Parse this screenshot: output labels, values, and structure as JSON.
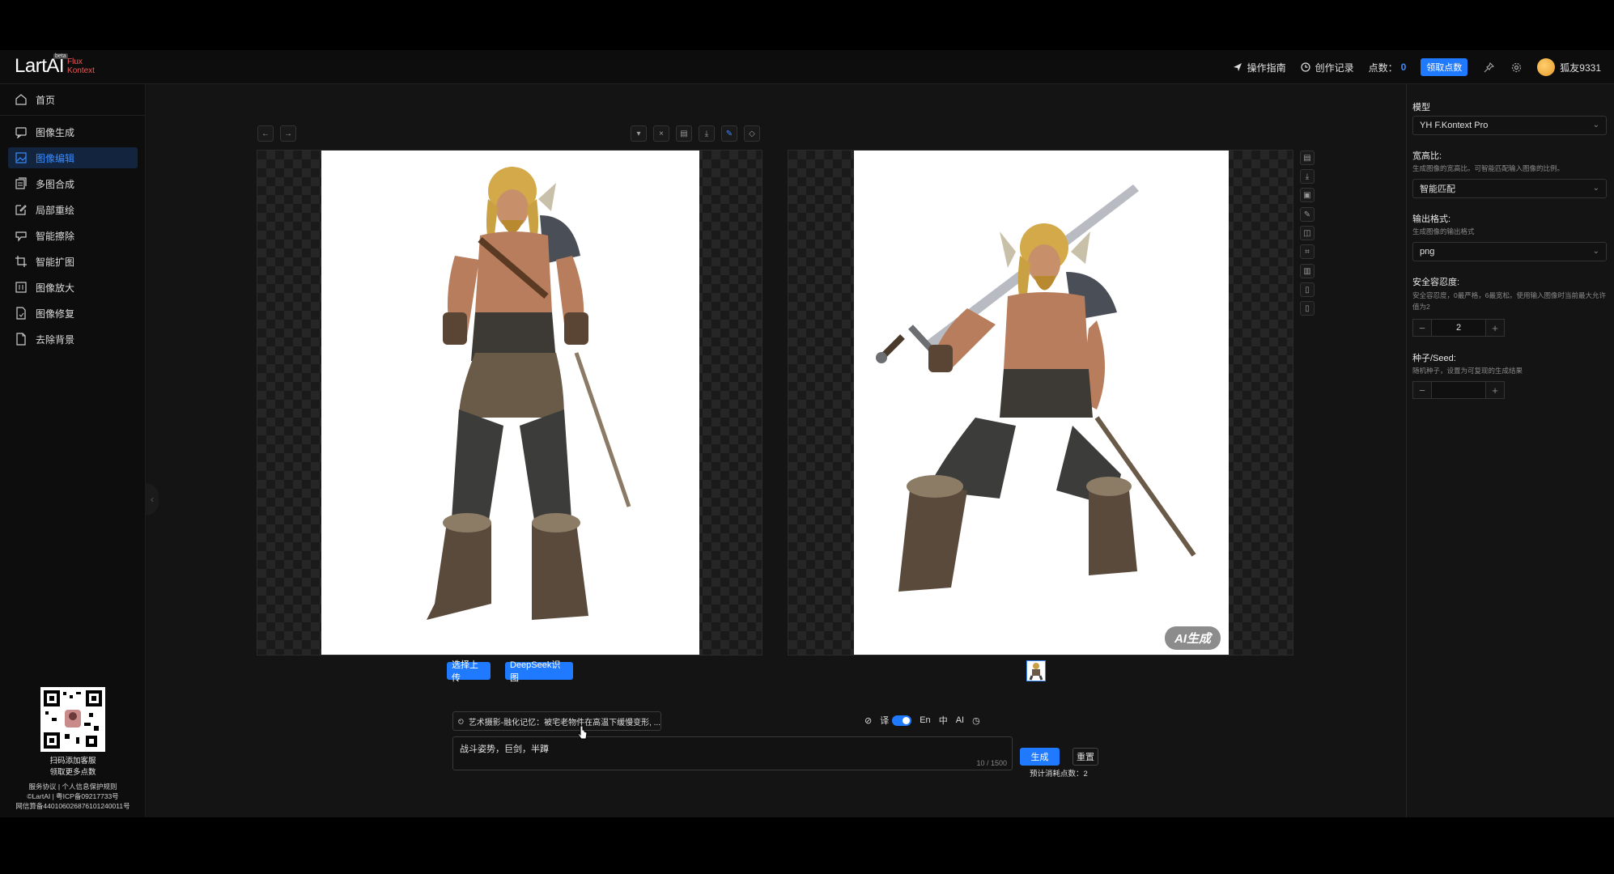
{
  "header": {
    "logo_main": "LartAI",
    "logo_sub_1": "Flux",
    "logo_sub_2": "Kontext",
    "logo_badge": "beta",
    "guide": "操作指南",
    "history": "创作记录",
    "points_label": "点数：",
    "points_value": "0",
    "claim_button": "领取点数",
    "username": "狐友9331"
  },
  "sidebar": {
    "items": [
      {
        "label": "首页",
        "icon": "home-icon"
      },
      {
        "label": "图像生成",
        "icon": "chat-image-icon"
      },
      {
        "label": "图像编辑",
        "icon": "image-edit-icon"
      },
      {
        "label": "多图合成",
        "icon": "layers-icon"
      },
      {
        "label": "局部重绘",
        "icon": "pencil-square-icon"
      },
      {
        "label": "智能擦除",
        "icon": "eraser-icon"
      },
      {
        "label": "智能扩图",
        "icon": "crop-icon"
      },
      {
        "label": "图像放大",
        "icon": "upscale-icon"
      },
      {
        "label": "图像修复",
        "icon": "repair-icon"
      },
      {
        "label": "去除背景",
        "icon": "remove-bg-icon"
      }
    ],
    "active_index": 2,
    "qr_line1": "扫码添加客服",
    "qr_line2": "领取更多点数",
    "footer_line1": "服务协议 | 个人信息保护规则",
    "footer_line2": "©LartAI | 粤ICP备09217733号",
    "footer_line3": "网信算备440106026876101240011号"
  },
  "editor": {
    "upload_button": "选择上传",
    "deepseek_button": "DeepSeek识图",
    "ai_badge": "AI生成"
  },
  "prompt": {
    "preset_text": "艺术摄影-融化记忆：被宅老物件在高温下缓慢变形, ...",
    "text": "战斗姿势，巨剑，半蹲",
    "counter": "10 / 1500",
    "translate_label": "译",
    "lang_en": "En",
    "lang_zh": "中",
    "ai_label": "AI",
    "generate_button": "生成",
    "reset_button": "重置",
    "estimate": "预计消耗点数：2"
  },
  "settings": {
    "model_label": "模型",
    "model_value": "YH F.Kontext Pro",
    "ratio_label": "宽高比:",
    "ratio_desc": "生成图像的宽高比。可智能匹配输入图像的比例。",
    "ratio_value": "智能匹配",
    "format_label": "输出格式:",
    "format_desc": "生成图像的输出格式",
    "format_value": "png",
    "safety_label": "安全容忍度:",
    "safety_desc": "安全容忍度，0最严格，6最宽松。使用输入图像时当前最大允许值为2",
    "safety_value": "2",
    "seed_label": "种子/Seed:",
    "seed_desc": "随机种子，设置为可复现的生成结果",
    "seed_value": ""
  }
}
